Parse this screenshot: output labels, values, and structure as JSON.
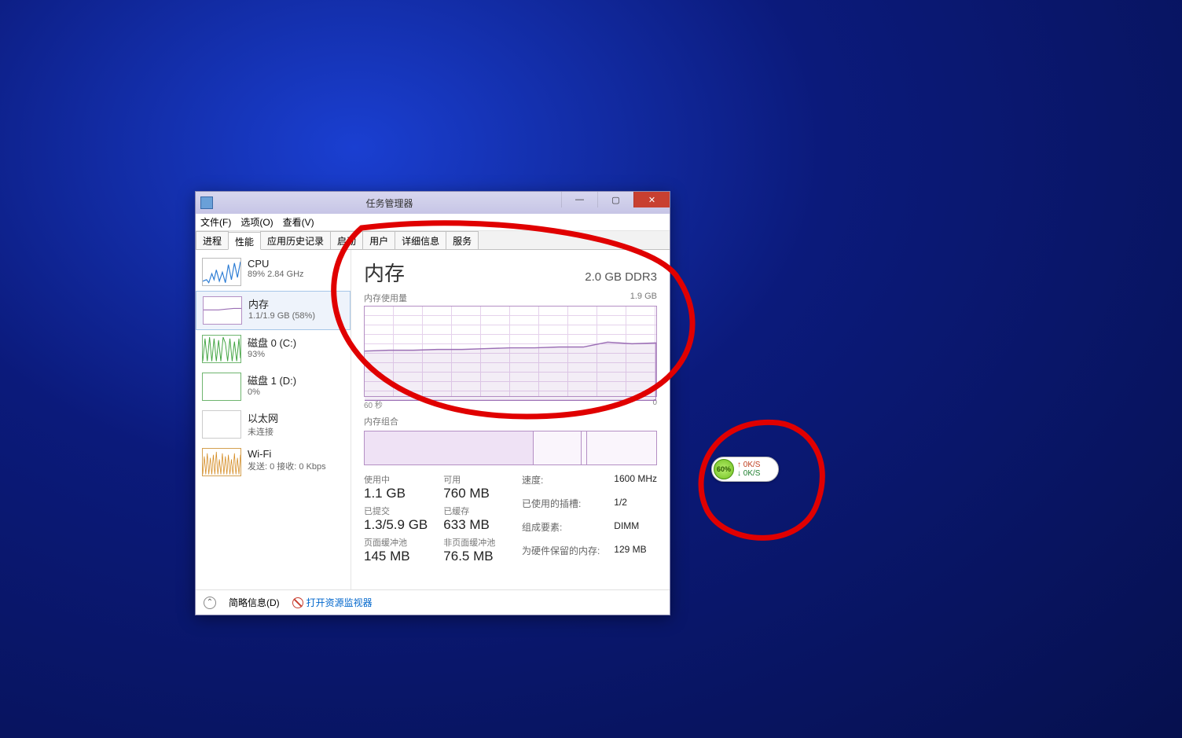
{
  "window": {
    "title": "任务管理器",
    "menus": {
      "file": "文件(F)",
      "options": "选项(O)",
      "view": "查看(V)"
    },
    "tabs": {
      "processes": "进程",
      "performance": "性能",
      "apphistory": "应用历史记录",
      "startup": "启动",
      "users": "用户",
      "details": "详细信息",
      "services": "服务"
    },
    "footer": {
      "fewer": "简略信息(D)",
      "resmon": "打开资源监视器"
    }
  },
  "sidebar": {
    "cpu": {
      "name": "CPU",
      "sub": "89% 2.84 GHz"
    },
    "memory": {
      "name": "内存",
      "sub": "1.1/1.9 GB (58%)"
    },
    "disk0": {
      "name": "磁盘 0 (C:)",
      "sub": "93%"
    },
    "disk1": {
      "name": "磁盘 1 (D:)",
      "sub": "0%"
    },
    "eth": {
      "name": "以太网",
      "sub": "未连接"
    },
    "wifi": {
      "name": "Wi-Fi",
      "sub": "发送: 0 接收: 0 Kbps"
    }
  },
  "detail": {
    "title": "内存",
    "capacity": "2.0 GB DDR3",
    "usage_label": "内存使用量",
    "usage_max": "1.9 GB",
    "xaxis_left": "60 秒",
    "xaxis_right": "0",
    "composition_label": "内存组合",
    "stats": {
      "in_use": {
        "label": "使用中",
        "value": "1.1 GB"
      },
      "available": {
        "label": "可用",
        "value": "760 MB"
      },
      "committed": {
        "label": "已提交",
        "value": "1.3/5.9 GB"
      },
      "cached": {
        "label": "已缓存",
        "value": "633 MB"
      },
      "paged": {
        "label": "页面缓冲池",
        "value": "145 MB"
      },
      "nonpaged": {
        "label": "非页面缓冲池",
        "value": "76.5 MB"
      }
    },
    "right": {
      "speed": {
        "label": "速度:",
        "value": "1600 MHz"
      },
      "slots": {
        "label": "已使用的插槽:",
        "value": "1/2"
      },
      "form": {
        "label": "组成要素:",
        "value": "DIMM"
      },
      "reserved": {
        "label": "为硬件保留的内存:",
        "value": "129 MB"
      }
    }
  },
  "chart_data": {
    "type": "line",
    "title": "内存使用量",
    "xlabel": "60 秒 → 0",
    "ylabel": "GB",
    "ylim": [
      0,
      1.9
    ],
    "x": [
      0,
      5,
      10,
      15,
      20,
      25,
      30,
      35,
      40,
      45,
      50,
      55,
      60
    ],
    "values": [
      1.02,
      1.03,
      1.04,
      1.04,
      1.05,
      1.06,
      1.07,
      1.08,
      1.09,
      1.1,
      1.15,
      1.13,
      1.14
    ],
    "color": "#9b6fb5"
  },
  "netwidget": {
    "pct": "60%",
    "up": "0K/S",
    "down": "0K/S"
  }
}
